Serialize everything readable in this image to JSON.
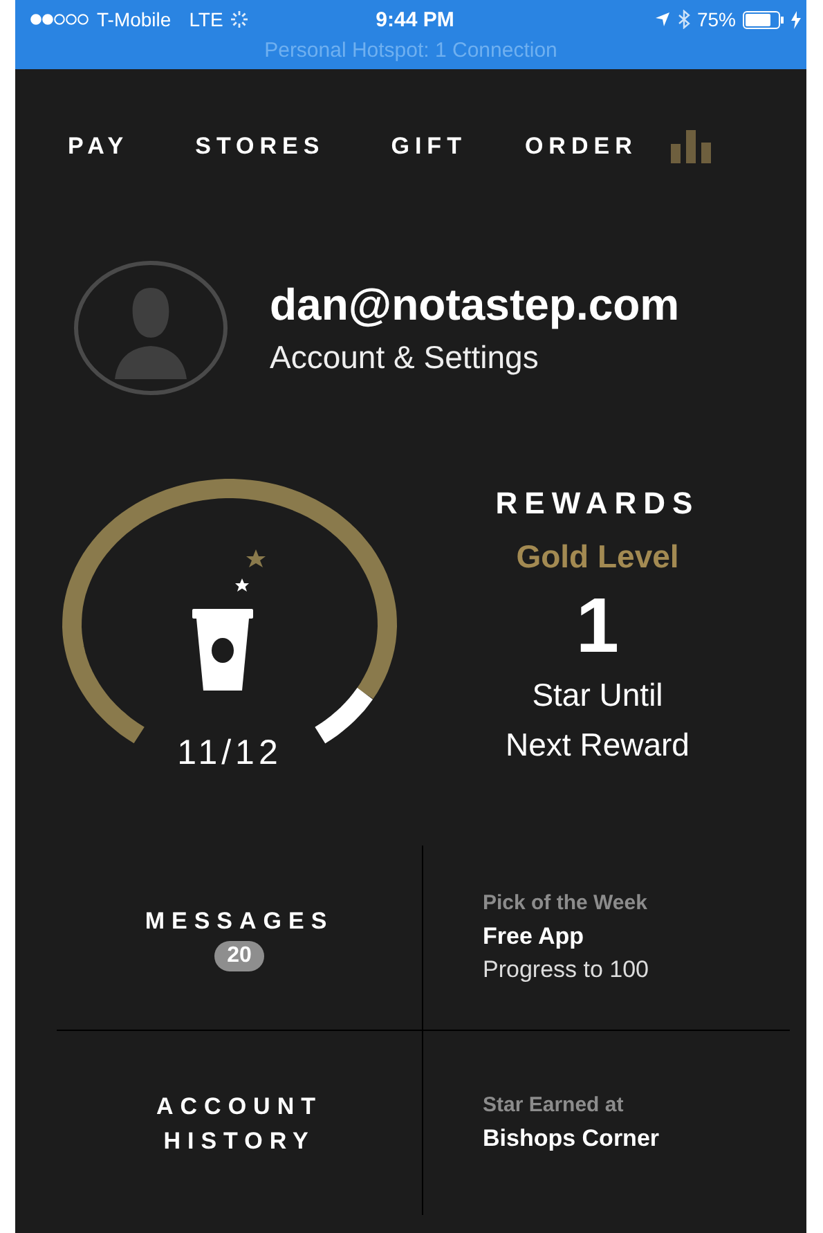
{
  "status_bar": {
    "carrier": "T-Mobile",
    "network": "LTE",
    "time": "9:44 PM",
    "battery": "75%",
    "hotspot": "Personal Hotspot: 1 Connection"
  },
  "nav": {
    "tabs": [
      {
        "label": "PAY"
      },
      {
        "label": "STORES"
      },
      {
        "label": "GIFT"
      },
      {
        "label": "ORDER"
      }
    ]
  },
  "profile": {
    "email": "dan@notastep.com",
    "link": "Account & Settings"
  },
  "rewards": {
    "title": "REWARDS",
    "tier": "Gold Level",
    "count": "1",
    "caption_lines": [
      "Star Until",
      "Next Reward"
    ],
    "progress": "11/12"
  },
  "tile_rows": [
    {
      "cells": [
        {
          "kind": "heading",
          "lines": [
            "MESSAGES"
          ],
          "badge": "20"
        },
        {
          "kind": "info",
          "label": "Pick of the Week",
          "title": "Free App",
          "detail": "Progress to 100"
        }
      ]
    },
    {
      "cells": [
        {
          "kind": "heading",
          "lines": [
            "ACCOUNT",
            "HISTORY"
          ]
        },
        {
          "kind": "info",
          "label": "Star Earned at",
          "title": "Bishops Corner"
        }
      ]
    }
  ]
}
